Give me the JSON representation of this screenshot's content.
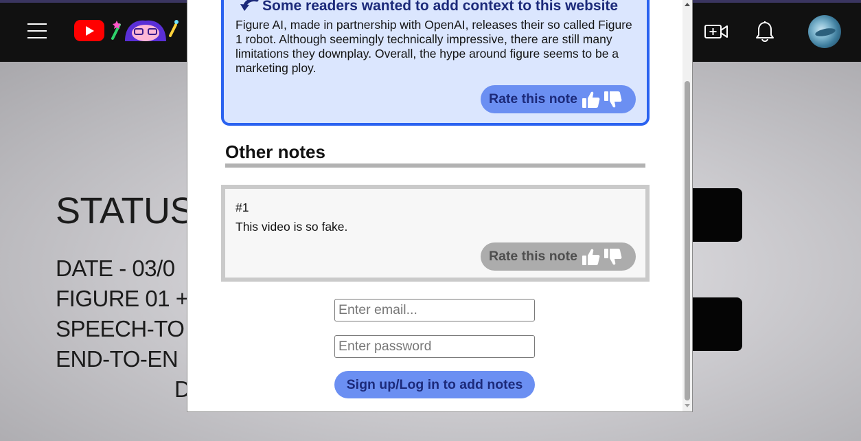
{
  "video_slide": {
    "title": "STATUS",
    "lines": [
      "DATE - 03/0",
      "FIGURE 01 +",
      "SPEECH-TO",
      "END-TO-EN",
      "D"
    ]
  },
  "context_note": {
    "heading": "Some readers wanted to add context to this website",
    "body": "Figure AI, made in partnership with OpenAI, releases their so called Figure 1 robot. Although seemingly technically impressive, there are still many limitations they downplay. Overall, the hype around figure seems to be a marketing ploy.",
    "rate_label": "Rate this note"
  },
  "other_notes": {
    "heading": "Other notes",
    "items": [
      {
        "number": "#1",
        "text": "This video is so fake.",
        "rate_label": "Rate this note"
      }
    ]
  },
  "auth": {
    "email_placeholder": "Enter email...",
    "password_placeholder": "Enter password",
    "submit_label": "Sign up/Log in to add notes"
  },
  "icons": {
    "menu": "hamburger-menu-icon",
    "logo": "youtube-logo-icon",
    "create": "video-camera-plus-icon",
    "notifications": "bell-icon",
    "rate_up": "thumbs-up-icon",
    "rate_down": "thumbs-down-icon",
    "context": "arrow-icon"
  },
  "colors": {
    "accent_blue": "#2a62f0",
    "button_blue": "#6b8ff2",
    "context_bg": "#dbe6fe",
    "heading_navy": "#1c2a7a",
    "note_border_gray": "#cacaca"
  }
}
